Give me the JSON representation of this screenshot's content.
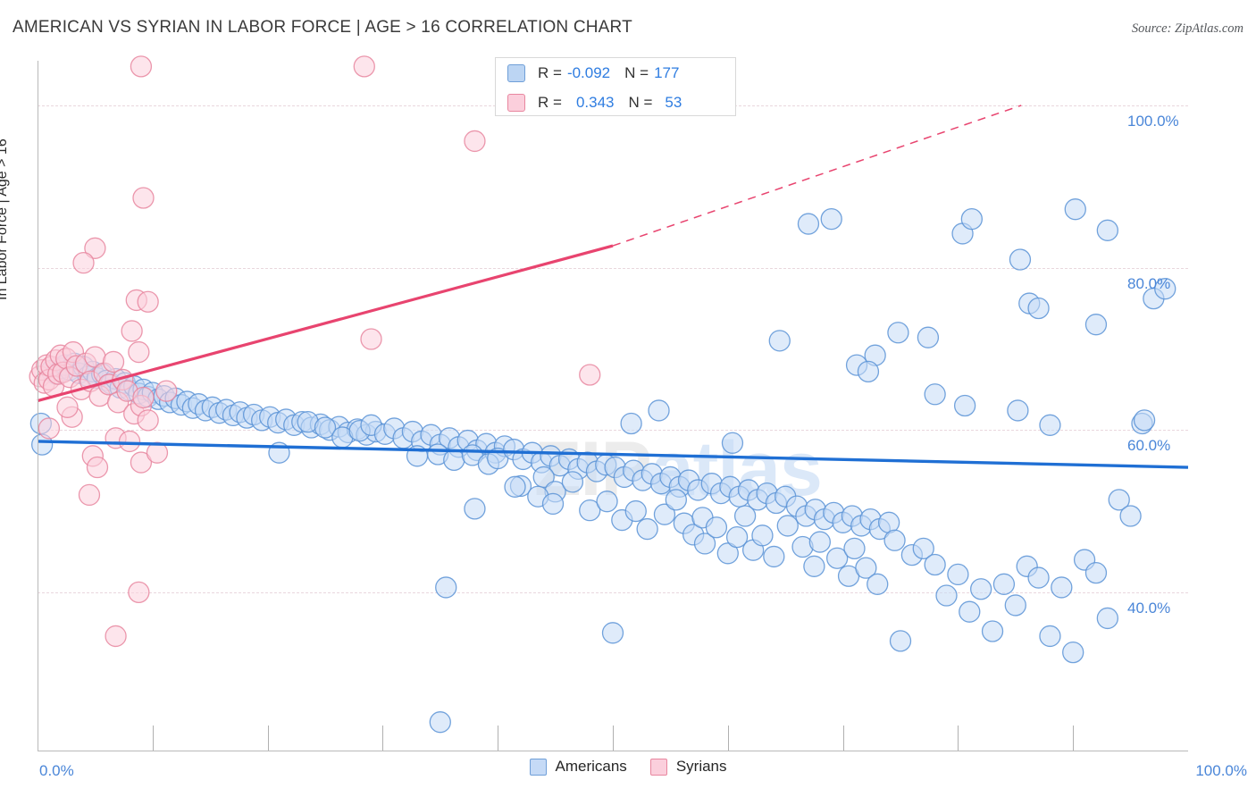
{
  "header": {
    "title": "AMERICAN VS SYRIAN IN LABOR FORCE | AGE > 16 CORRELATION CHART",
    "source": "Source: ZipAtlas.com"
  },
  "watermark": {
    "part1": "ZIP",
    "part2": "atlas"
  },
  "stat_legend": {
    "rows": [
      {
        "r_label": "R =",
        "r_value": "-0.092",
        "n_label": "N =",
        "n_value": "177",
        "color": "#bcd5f3"
      },
      {
        "r_label": "R =",
        "r_value": "0.343",
        "n_label": "N =",
        "n_value": "53",
        "color": "#fbcfdc"
      }
    ]
  },
  "series_legend": [
    {
      "label": "Americans",
      "color": "#c5daf6"
    },
    {
      "label": "Syrians",
      "color": "#fbcfdc"
    }
  ],
  "axes": {
    "y_title": "In Labor Force | Age > 16",
    "y_ticks": [
      "100.0%",
      "80.0%",
      "60.0%",
      "40.0%"
    ],
    "x_min_label": "0.0%",
    "x_max_label": "100.0%"
  },
  "chart_data": {
    "type": "scatter",
    "title": "AMERICAN VS SYRIAN IN LABOR FORCE | AGE > 16 CORRELATION CHART",
    "xlabel": "",
    "ylabel": "In Labor Force | Age > 16",
    "xlim": [
      0,
      100
    ],
    "ylim": [
      20.5,
      105.5
    ],
    "grid": true,
    "y_gridlines": [
      100,
      80,
      60,
      40
    ],
    "legend_position": "bottom-center",
    "series": [
      {
        "name": "Americans",
        "color": "#c5daf6",
        "edge_color": "#5b93d6",
        "r": -0.092,
        "n": 177,
        "trend": {
          "x0": 0,
          "y0": 58.6,
          "x1": 100,
          "y1": 55.4,
          "style": "solid",
          "color": "#1f6fd4"
        },
        "points": [
          [
            0.3,
            60.8
          ],
          [
            0.4,
            58.2
          ],
          [
            1.2,
            67.3
          ],
          [
            1.6,
            66.9
          ],
          [
            2.1,
            67.6
          ],
          [
            2.4,
            68.0
          ],
          [
            2.8,
            67.4
          ],
          [
            3.2,
            68.2
          ],
          [
            3.6,
            67.0
          ],
          [
            4.0,
            67.8
          ],
          [
            4.4,
            66.6
          ],
          [
            4.8,
            67.2
          ],
          [
            5.2,
            66.4
          ],
          [
            5.6,
            66.9
          ],
          [
            6.0,
            66.1
          ],
          [
            6.4,
            65.7
          ],
          [
            6.8,
            66.3
          ],
          [
            7.2,
            65.2
          ],
          [
            7.6,
            65.8
          ],
          [
            8.0,
            64.9
          ],
          [
            8.4,
            65.4
          ],
          [
            8.8,
            64.5
          ],
          [
            9.2,
            65.0
          ],
          [
            9.6,
            64.1
          ],
          [
            10.0,
            64.6
          ],
          [
            10.5,
            63.8
          ],
          [
            11.0,
            64.2
          ],
          [
            11.5,
            63.4
          ],
          [
            12.0,
            63.9
          ],
          [
            12.5,
            63.1
          ],
          [
            13.0,
            63.5
          ],
          [
            13.5,
            62.7
          ],
          [
            14.0,
            63.2
          ],
          [
            14.6,
            62.4
          ],
          [
            15.2,
            62.8
          ],
          [
            15.8,
            62.1
          ],
          [
            16.4,
            62.5
          ],
          [
            17.0,
            61.8
          ],
          [
            17.6,
            62.2
          ],
          [
            18.2,
            61.5
          ],
          [
            18.8,
            61.9
          ],
          [
            19.5,
            61.2
          ],
          [
            20.2,
            61.6
          ],
          [
            20.9,
            60.9
          ],
          [
            21.6,
            61.3
          ],
          [
            22.3,
            60.6
          ],
          [
            23.0,
            61.0
          ],
          [
            23.8,
            60.3
          ],
          [
            24.6,
            60.7
          ],
          [
            25.4,
            60.0
          ],
          [
            26.2,
            60.4
          ],
          [
            27.0,
            59.7
          ],
          [
            27.8,
            60.1
          ],
          [
            28.6,
            59.4
          ],
          [
            29.4,
            59.8
          ],
          [
            21.0,
            57.2
          ],
          [
            23.5,
            61.0
          ],
          [
            25.0,
            60.3
          ],
          [
            26.5,
            59.1
          ],
          [
            28.0,
            59.9
          ],
          [
            29.0,
            60.6
          ],
          [
            30.2,
            59.5
          ],
          [
            31.0,
            60.2
          ],
          [
            31.8,
            59.0
          ],
          [
            32.6,
            59.8
          ],
          [
            33.4,
            58.6
          ],
          [
            34.2,
            59.4
          ],
          [
            35.0,
            58.2
          ],
          [
            35.8,
            59.0
          ],
          [
            36.6,
            57.9
          ],
          [
            37.4,
            58.7
          ],
          [
            38.2,
            57.5
          ],
          [
            39.0,
            58.3
          ],
          [
            39.8,
            57.2
          ],
          [
            40.6,
            58.0
          ],
          [
            33.0,
            56.8
          ],
          [
            34.8,
            57.0
          ],
          [
            36.2,
            56.3
          ],
          [
            37.8,
            56.9
          ],
          [
            39.2,
            55.8
          ],
          [
            40.0,
            56.5
          ],
          [
            41.4,
            57.6
          ],
          [
            42.2,
            56.4
          ],
          [
            43.0,
            57.2
          ],
          [
            43.8,
            56.0
          ],
          [
            44.6,
            56.8
          ],
          [
            45.4,
            55.6
          ],
          [
            46.2,
            56.4
          ],
          [
            47.0,
            55.2
          ],
          [
            47.8,
            56.0
          ],
          [
            48.6,
            54.9
          ],
          [
            49.4,
            55.7
          ],
          [
            42.0,
            53.1
          ],
          [
            44.0,
            54.2
          ],
          [
            45.0,
            52.4
          ],
          [
            46.5,
            53.6
          ],
          [
            38.0,
            50.3
          ],
          [
            41.5,
            53.0
          ],
          [
            43.5,
            51.8
          ],
          [
            44.8,
            50.9
          ],
          [
            50.2,
            55.4
          ],
          [
            51.0,
            54.2
          ],
          [
            51.8,
            55.0
          ],
          [
            52.6,
            53.8
          ],
          [
            53.4,
            54.6
          ],
          [
            54.2,
            53.4
          ],
          [
            55.0,
            54.2
          ],
          [
            55.8,
            53.0
          ],
          [
            56.6,
            53.8
          ],
          [
            57.4,
            52.6
          ],
          [
            48.0,
            50.1
          ],
          [
            49.5,
            51.2
          ],
          [
            50.8,
            48.9
          ],
          [
            52.0,
            50.0
          ],
          [
            53.0,
            47.8
          ],
          [
            54.5,
            49.6
          ],
          [
            55.5,
            51.4
          ],
          [
            56.2,
            48.5
          ],
          [
            57.0,
            47.1
          ],
          [
            57.8,
            49.2
          ],
          [
            58.6,
            53.4
          ],
          [
            59.4,
            52.2
          ],
          [
            60.2,
            53.0
          ],
          [
            61.0,
            51.8
          ],
          [
            61.8,
            52.6
          ],
          [
            62.6,
            51.4
          ],
          [
            58.0,
            46.0
          ],
          [
            59.0,
            48.0
          ],
          [
            60.0,
            44.8
          ],
          [
            60.8,
            46.8
          ],
          [
            61.5,
            49.4
          ],
          [
            62.2,
            45.2
          ],
          [
            63.4,
            52.2
          ],
          [
            64.2,
            51.0
          ],
          [
            65.0,
            51.8
          ],
          [
            63.0,
            47.0
          ],
          [
            64.0,
            44.4
          ],
          [
            65.2,
            48.2
          ],
          [
            66.0,
            50.6
          ],
          [
            66.8,
            49.4
          ],
          [
            67.6,
            50.2
          ],
          [
            68.4,
            49.0
          ],
          [
            66.5,
            45.6
          ],
          [
            67.5,
            43.2
          ],
          [
            68.0,
            46.2
          ],
          [
            69.2,
            49.8
          ],
          [
            70.0,
            48.6
          ],
          [
            70.8,
            49.4
          ],
          [
            71.6,
            48.2
          ],
          [
            69.5,
            44.2
          ],
          [
            70.5,
            42.0
          ],
          [
            71.0,
            45.4
          ],
          [
            72.4,
            49.0
          ],
          [
            73.2,
            47.8
          ],
          [
            74.0,
            48.6
          ],
          [
            72.0,
            43.0
          ],
          [
            73.0,
            41.0
          ],
          [
            74.5,
            46.4
          ],
          [
            75.0,
            34.0
          ],
          [
            76.0,
            44.6
          ],
          [
            77.0,
            45.4
          ],
          [
            78.0,
            43.4
          ],
          [
            79.0,
            39.6
          ],
          [
            80.0,
            42.2
          ],
          [
            81.0,
            37.6
          ],
          [
            82.0,
            40.4
          ],
          [
            83.0,
            35.2
          ],
          [
            84.0,
            41.0
          ],
          [
            85.0,
            38.4
          ],
          [
            86.0,
            43.2
          ],
          [
            87.0,
            41.8
          ],
          [
            88.0,
            34.6
          ],
          [
            89.0,
            40.6
          ],
          [
            90.0,
            32.6
          ],
          [
            91.0,
            44.0
          ],
          [
            92.0,
            42.4
          ],
          [
            93.0,
            36.8
          ],
          [
            94.0,
            51.4
          ],
          [
            95.0,
            49.4
          ],
          [
            96.0,
            60.8
          ],
          [
            97.0,
            76.2
          ],
          [
            98.0,
            77.4
          ],
          [
            35.5,
            40.6
          ],
          [
            50.0,
            35.0
          ],
          [
            64.5,
            71.0
          ],
          [
            67.0,
            85.4
          ],
          [
            69.0,
            86.0
          ],
          [
            72.8,
            69.2
          ],
          [
            74.8,
            72.0
          ],
          [
            77.4,
            71.4
          ],
          [
            80.4,
            84.2
          ],
          [
            81.2,
            86.0
          ],
          [
            85.4,
            81.0
          ],
          [
            86.2,
            75.6
          ],
          [
            87.0,
            75.0
          ],
          [
            90.2,
            87.2
          ],
          [
            92.0,
            73.0
          ],
          [
            93.0,
            84.6
          ],
          [
            71.2,
            68.0
          ],
          [
            72.2,
            67.2
          ],
          [
            78.0,
            64.4
          ],
          [
            80.6,
            63.0
          ],
          [
            85.2,
            62.4
          ],
          [
            88.0,
            60.6
          ],
          [
            96.2,
            61.2
          ],
          [
            51.6,
            60.8
          ],
          [
            54.0,
            62.4
          ],
          [
            60.4,
            58.4
          ],
          [
            35.0,
            24.0
          ]
        ]
      },
      {
        "name": "Syrians",
        "color": "#fbcfdc",
        "edge_color": "#e8869f",
        "r": 0.343,
        "n": 53,
        "trend": {
          "x0": 0,
          "y0": 63.6,
          "x1": 50,
          "y1": 82.7,
          "style": "solid",
          "color": "#e8446f"
        },
        "trend_dashed": {
          "x0": 50,
          "y0": 82.7,
          "x1": 85.5,
          "y1": 100.0,
          "style": "dashed",
          "color": "#e8446f"
        },
        "points": [
          [
            0.2,
            66.6
          ],
          [
            0.4,
            67.4
          ],
          [
            0.6,
            65.8
          ],
          [
            0.8,
            68.0
          ],
          [
            1.0,
            66.2
          ],
          [
            1.2,
            67.8
          ],
          [
            1.4,
            65.4
          ],
          [
            1.6,
            68.6
          ],
          [
            1.8,
            66.9
          ],
          [
            2.0,
            69.2
          ],
          [
            2.2,
            67.1
          ],
          [
            2.5,
            68.8
          ],
          [
            2.8,
            66.5
          ],
          [
            3.1,
            69.6
          ],
          [
            3.4,
            67.9
          ],
          [
            3.8,
            65.0
          ],
          [
            4.2,
            68.2
          ],
          [
            4.6,
            66.0
          ],
          [
            5.0,
            69.0
          ],
          [
            5.4,
            64.2
          ],
          [
            5.8,
            67.0
          ],
          [
            6.2,
            65.6
          ],
          [
            6.6,
            68.4
          ],
          [
            7.0,
            63.4
          ],
          [
            7.4,
            66.2
          ],
          [
            7.8,
            64.8
          ],
          [
            8.4,
            62.0
          ],
          [
            9.0,
            63.0
          ],
          [
            9.6,
            61.2
          ],
          [
            4.8,
            56.8
          ],
          [
            5.2,
            55.4
          ],
          [
            6.8,
            59.0
          ],
          [
            8.0,
            58.6
          ],
          [
            3.0,
            61.6
          ],
          [
            2.6,
            62.8
          ],
          [
            1.0,
            60.2
          ],
          [
            5.0,
            82.4
          ],
          [
            4.0,
            80.6
          ],
          [
            8.6,
            76.0
          ],
          [
            9.6,
            75.8
          ],
          [
            8.2,
            72.2
          ],
          [
            8.8,
            69.6
          ],
          [
            9.2,
            64.0
          ],
          [
            9.0,
            56.0
          ],
          [
            10.4,
            57.2
          ],
          [
            11.2,
            64.8
          ],
          [
            4.5,
            52.0
          ],
          [
            8.8,
            40.0
          ],
          [
            6.8,
            34.6
          ],
          [
            9.2,
            88.6
          ],
          [
            9.0,
            104.8
          ],
          [
            28.4,
            104.8
          ],
          [
            38.0,
            95.6
          ],
          [
            29.0,
            71.2
          ],
          [
            48.0,
            66.8
          ]
        ]
      }
    ]
  }
}
